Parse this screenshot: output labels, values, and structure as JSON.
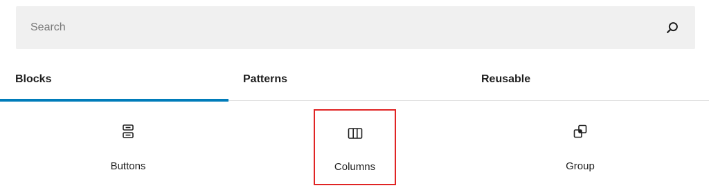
{
  "search": {
    "placeholder": "Search",
    "icon": "search-icon"
  },
  "tabs": [
    {
      "label": "Blocks",
      "selected": true
    },
    {
      "label": "Patterns",
      "selected": false
    },
    {
      "label": "Reusable",
      "selected": false
    }
  ],
  "blocks": [
    {
      "label": "Buttons",
      "icon": "buttons-icon"
    },
    {
      "label": "Columns",
      "icon": "columns-icon",
      "highlighted": true
    },
    {
      "label": "Group",
      "icon": "group-icon"
    }
  ],
  "colors": {
    "accent": "#007cba",
    "highlight": "#e02424",
    "search_bg": "#f0f0f0"
  }
}
